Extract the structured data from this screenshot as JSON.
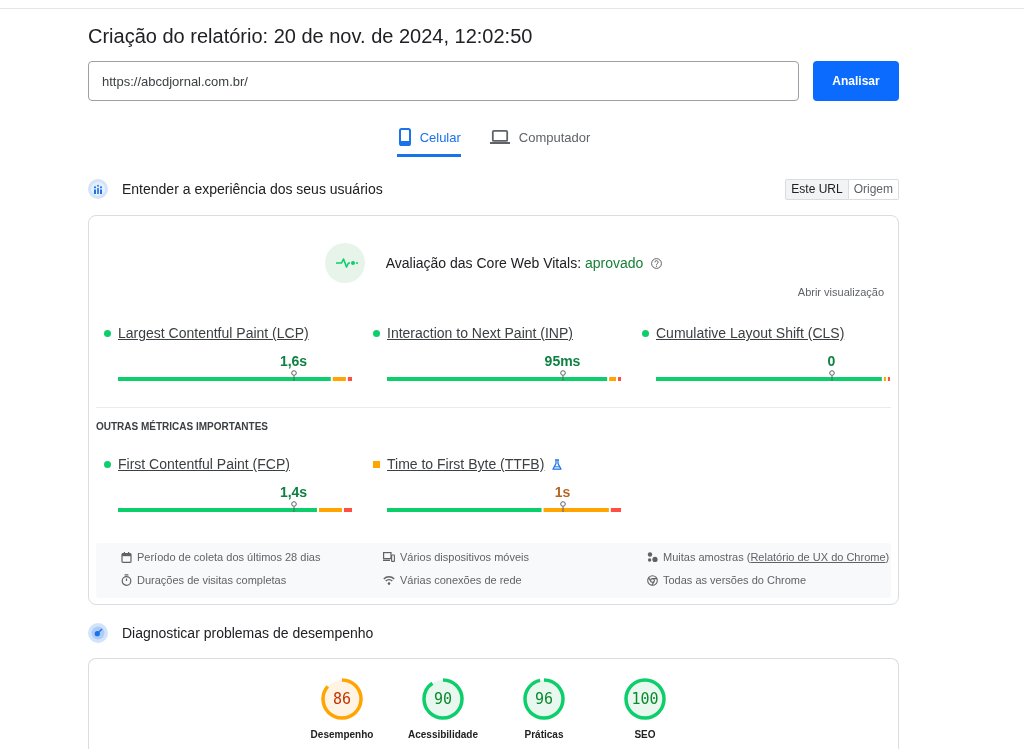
{
  "report": {
    "title": "Criação do relatório: 20 de nov. de 2024, 12:02:50"
  },
  "url_bar": {
    "value": "https://abcdjornal.com.br/",
    "button": "Analisar"
  },
  "tabs": [
    {
      "label": "Celular",
      "kind": "mobile",
      "selected": true
    },
    {
      "label": "Computador",
      "kind": "desktop",
      "selected": false
    }
  ],
  "field_section": {
    "title": "Entender a experiência dos seus usuários",
    "scope_options": [
      {
        "label": "Este URL",
        "selected": true
      },
      {
        "label": "Origem",
        "selected": false
      }
    ],
    "assessment": {
      "label": "Avaliação das Core Web Vitals:",
      "result": "aprovado",
      "passed": true
    },
    "open_view": "Abrir visualização",
    "core_metrics": [
      {
        "name": "Largest Contentful Paint (LCP)",
        "kind": "good",
        "experimental": false,
        "value": "1,6s",
        "level": 0.75
      },
      {
        "name": "Interaction to Next Paint (INP)",
        "kind": "good",
        "experimental": false,
        "value": "95ms",
        "level": 0.75
      },
      {
        "name": "Cumulative Layout Shift (CLS)",
        "kind": "good",
        "experimental": false,
        "value": "0",
        "level": 0.75
      }
    ],
    "other_heading": "OUTRAS MÉTRICAS IMPORTANTES",
    "other_metrics": [
      {
        "name": "First Contentful Paint (FCP)",
        "kind": "good",
        "experimental": false,
        "value": "1,4s",
        "level": 0.75
      },
      {
        "name": "Time to First Byte (TTFB)",
        "kind": "average",
        "experimental": true,
        "value": "1s",
        "level": 0.75
      }
    ],
    "info": [
      {
        "kind": "period",
        "text": "Período de coleta dos últimos 28 dias"
      },
      {
        "kind": "devices",
        "text": "Vários dispositivos móveis"
      },
      {
        "kind": "samples",
        "text": "Muitas amostras (",
        "link": "Relatório de UX do Chrome",
        "after": ")"
      },
      {
        "kind": "duration",
        "text": "Durações de visitas completas"
      },
      {
        "kind": "connections",
        "text": "Várias conexões de rede"
      },
      {
        "kind": "versions",
        "text": "Todas as versões do Chrome"
      }
    ]
  },
  "lab_section": {
    "title": "Diagnosticar problemas de desempenho",
    "gauges": [
      {
        "score": "86",
        "label": "Desempenho",
        "kind": "average"
      },
      {
        "score": "90",
        "label": "Acessibilidade",
        "kind": "good"
      },
      {
        "score": "96",
        "label": "Práticas",
        "kind": "good"
      },
      {
        "score": "100",
        "label": "SEO",
        "kind": "good"
      }
    ]
  }
}
